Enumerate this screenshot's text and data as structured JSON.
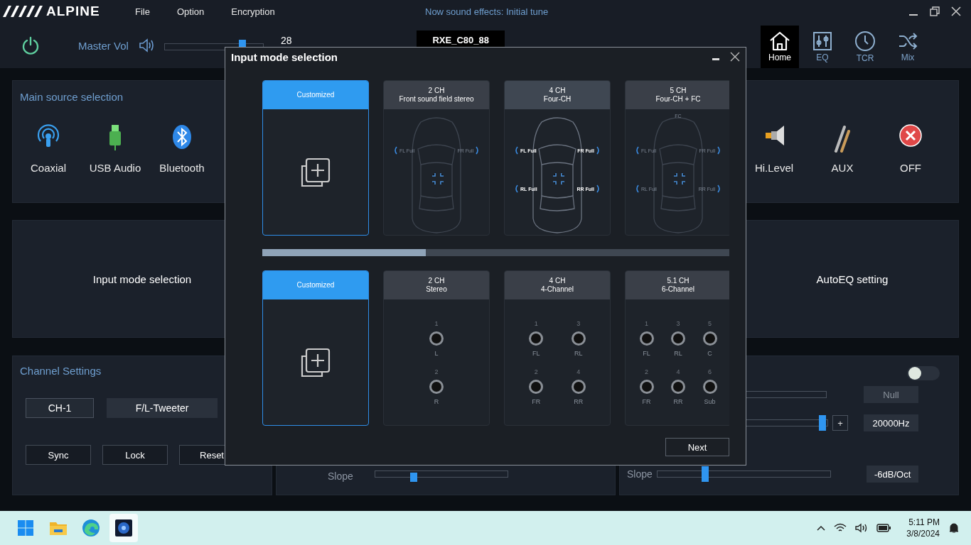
{
  "app": {
    "logo": "ALPINE",
    "menu": [
      "File",
      "Option",
      "Encryption"
    ],
    "status": "Now sound effects: Initial tune"
  },
  "controls": {
    "volume_label": "Master Vol",
    "volume": {
      "level": 0.79
    },
    "volume_value": "28",
    "device": "RXE_C80_88"
  },
  "nav": [
    {
      "label": "Home",
      "kind": "home",
      "selected": true
    },
    {
      "label": "EQ",
      "kind": "eq",
      "selected": false
    },
    {
      "label": "TCR",
      "kind": "clock",
      "selected": false
    },
    {
      "label": "Mix",
      "kind": "shuffle",
      "selected": false
    }
  ],
  "source": {
    "title": "Main source selection",
    "left": [
      {
        "label": "Coaxial",
        "kind": "coaxial"
      },
      {
        "label": "USB Audio",
        "kind": "usb"
      },
      {
        "label": "Bluetooth",
        "kind": "bluetooth"
      }
    ],
    "right": [
      {
        "label": "Hi.Level",
        "kind": "speaker"
      },
      {
        "label": "AUX",
        "kind": "aux"
      },
      {
        "label": "OFF",
        "kind": "off"
      }
    ]
  },
  "panels": [
    "Input mode selection",
    "AutoEQ setting"
  ],
  "channel": {
    "title": "Channel Settings",
    "channel": "CH-1",
    "speaker": "F/L-Tweeter",
    "buttons": [
      "Sync",
      "Lock",
      "Reset"
    ]
  },
  "filter": {
    "label": "Slope",
    "slider": {
      "level": 0.29
    }
  },
  "output": {
    "toggle": {
      "on": false
    },
    "rows": [
      {
        "kind": "bar",
        "value": "Null"
      },
      {
        "kind": "slider",
        "level": 0.97,
        "button": "+",
        "value": "20000Hz"
      },
      {
        "kind": "slider",
        "label": "Slope",
        "level": 0.28,
        "value": "-6dB/Oct"
      }
    ]
  },
  "dialog": {
    "title": "Input mode selection",
    "progress": {
      "level": 0.35
    },
    "next": "Next",
    "speaker_cards": [
      {
        "kind": "custom",
        "title": "Customized",
        "selected": true
      },
      {
        "kind": "car",
        "title": "2 CH",
        "subtitle": "Front sound field stereo",
        "selected": false,
        "highlighted": false,
        "speakers": [
          {
            "kind": "fl",
            "label": "FL Full"
          },
          {
            "kind": "fr",
            "label": "FR Full"
          }
        ]
      },
      {
        "kind": "car",
        "title": "4 CH",
        "subtitle": "Four-CH",
        "selected": false,
        "highlighted": true,
        "speakers": [
          {
            "kind": "fl",
            "label": "FL Full"
          },
          {
            "kind": "fr",
            "label": "FR Full"
          },
          {
            "kind": "rl",
            "label": "RL Full"
          },
          {
            "kind": "rr",
            "label": "RR Full"
          }
        ]
      },
      {
        "kind": "car",
        "title": "5 CH",
        "subtitle": "Four-CH + FC",
        "selected": false,
        "highlighted": false,
        "speakers": [
          {
            "kind": "fc",
            "label": "FC"
          },
          {
            "kind": "fl",
            "label": "FL Full"
          },
          {
            "kind": "fr",
            "label": "FR Full"
          },
          {
            "kind": "rl",
            "label": "RL Full"
          },
          {
            "kind": "rr",
            "label": "RR Full"
          }
        ]
      }
    ],
    "input_cards": [
      {
        "kind": "custom",
        "title": "Customized",
        "selected": true
      },
      {
        "kind": "ports",
        "title": "2 CH",
        "subtitle": "Stereo",
        "selected": false,
        "rows": [
          [
            {
              "num": "1",
              "label": "L"
            }
          ],
          [
            {
              "num": "2",
              "label": "R"
            }
          ]
        ]
      },
      {
        "kind": "ports",
        "title": "4 CH",
        "subtitle": "4-Channel",
        "selected": false,
        "rows": [
          [
            {
              "num": "1",
              "label": "FL"
            },
            {
              "num": "3",
              "label": "RL"
            }
          ],
          [
            {
              "num": "2",
              "label": "FR"
            },
            {
              "num": "4",
              "label": "RR"
            }
          ]
        ]
      },
      {
        "kind": "ports",
        "title": "5.1 CH",
        "subtitle": "6-Channel",
        "selected": false,
        "rows": [
          [
            {
              "num": "1",
              "label": "FL"
            },
            {
              "num": "3",
              "label": "RL"
            },
            {
              "num": "5",
              "label": "C"
            }
          ],
          [
            {
              "num": "2",
              "label": "FR"
            },
            {
              "num": "4",
              "label": "RR"
            },
            {
              "num": "6",
              "label": "Sub"
            }
          ]
        ]
      }
    ]
  },
  "taskbar": {
    "apps": [
      {
        "kind": "start",
        "selected": false
      },
      {
        "kind": "folder",
        "selected": false
      },
      {
        "kind": "edge",
        "selected": false
      },
      {
        "kind": "app",
        "selected": true
      }
    ],
    "time": "5:11 PM",
    "date": "3/8/2024"
  }
}
